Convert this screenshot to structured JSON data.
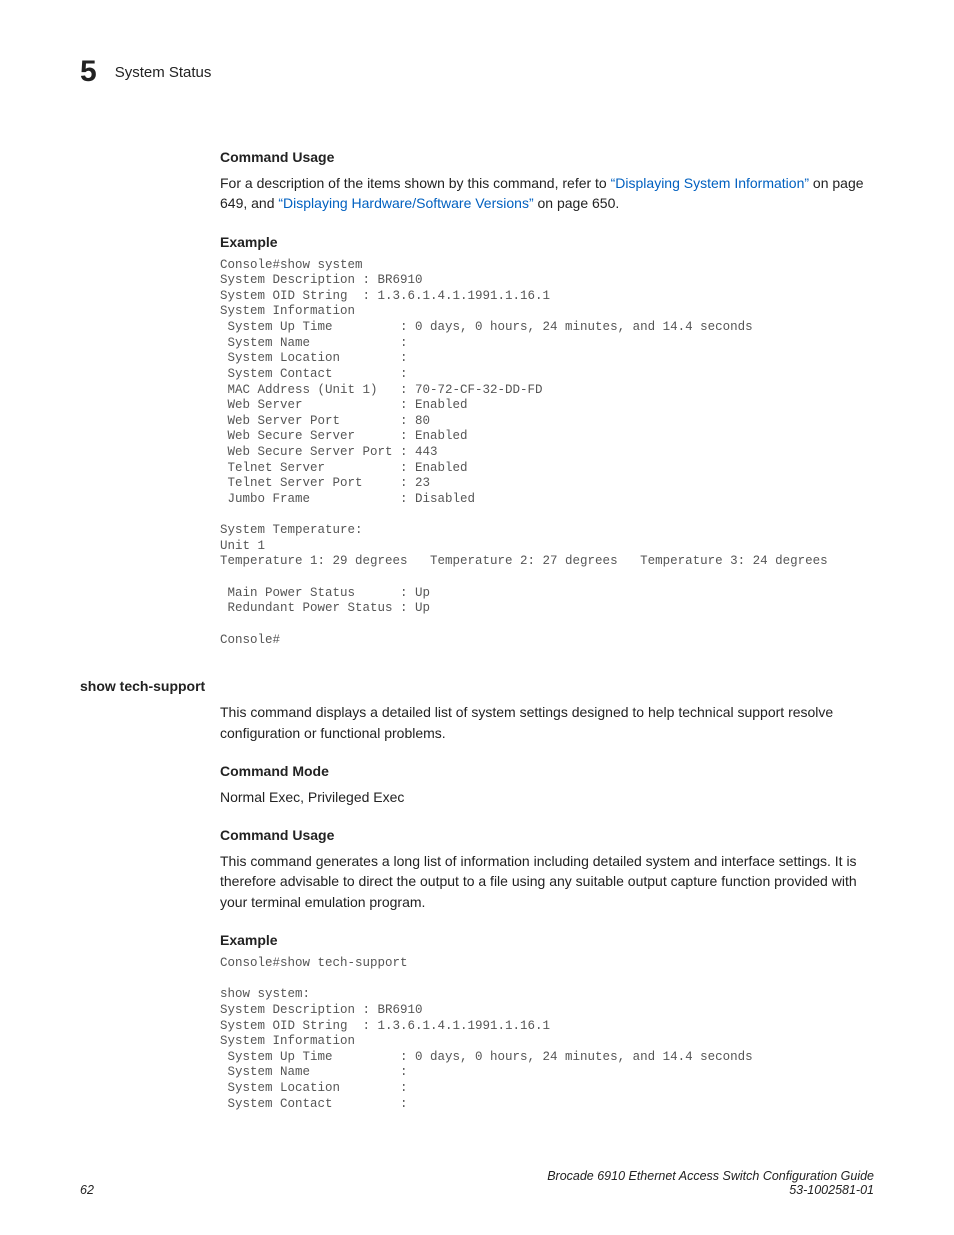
{
  "header": {
    "chapter_number": "5",
    "chapter_title": "System Status"
  },
  "sections": {
    "command_usage_1": {
      "heading": "Command Usage",
      "text_pre": "For a description of the items shown by this command, refer to ",
      "link1": "“Displaying System Information”",
      "text_mid": " on page 649, and ",
      "link2": "“Displaying Hardware/Software Versions”",
      "text_post": " on page 650."
    },
    "example_1": {
      "heading": "Example",
      "code": "Console#show system\nSystem Description : BR6910\nSystem OID String  : 1.3.6.1.4.1.1991.1.16.1\nSystem Information\n System Up Time         : 0 days, 0 hours, 24 minutes, and 14.4 seconds\n System Name            :\n System Location        :\n System Contact         :\n MAC Address (Unit 1)   : 70-72-CF-32-DD-FD\n Web Server             : Enabled\n Web Server Port        : 80\n Web Secure Server      : Enabled\n Web Secure Server Port : 443\n Telnet Server          : Enabled\n Telnet Server Port     : 23\n Jumbo Frame            : Disabled\n\nSystem Temperature:\nUnit 1\nTemperature 1: 29 degrees   Temperature 2: 27 degrees   Temperature 3: 24 degrees\n\n Main Power Status      : Up\n Redundant Power Status : Up\n\nConsole#"
    },
    "show_tech_support": {
      "label": "show tech-support",
      "intro": "This command displays a detailed list of system settings designed to help technical support resolve configuration or functional problems.",
      "command_mode_heading": "Command Mode",
      "command_mode_text": "Normal Exec, Privileged Exec",
      "command_usage_heading": "Command Usage",
      "command_usage_text": "This command generates a long list of information including detailed system and interface settings. It is therefore advisable to direct the output to a file using any suitable output capture function provided with your terminal emulation program.",
      "example_heading": "Example",
      "example_code": "Console#show tech-support\n\nshow system:\nSystem Description : BR6910\nSystem OID String  : 1.3.6.1.4.1.1991.1.16.1\nSystem Information\n System Up Time         : 0 days, 0 hours, 24 minutes, and 14.4 seconds\n System Name            :\n System Location        :\n System Contact         :"
    }
  },
  "footer": {
    "page_number": "62",
    "doc_title": "Brocade 6910 Ethernet Access Switch Configuration Guide",
    "doc_id": "53-1002581-01"
  }
}
